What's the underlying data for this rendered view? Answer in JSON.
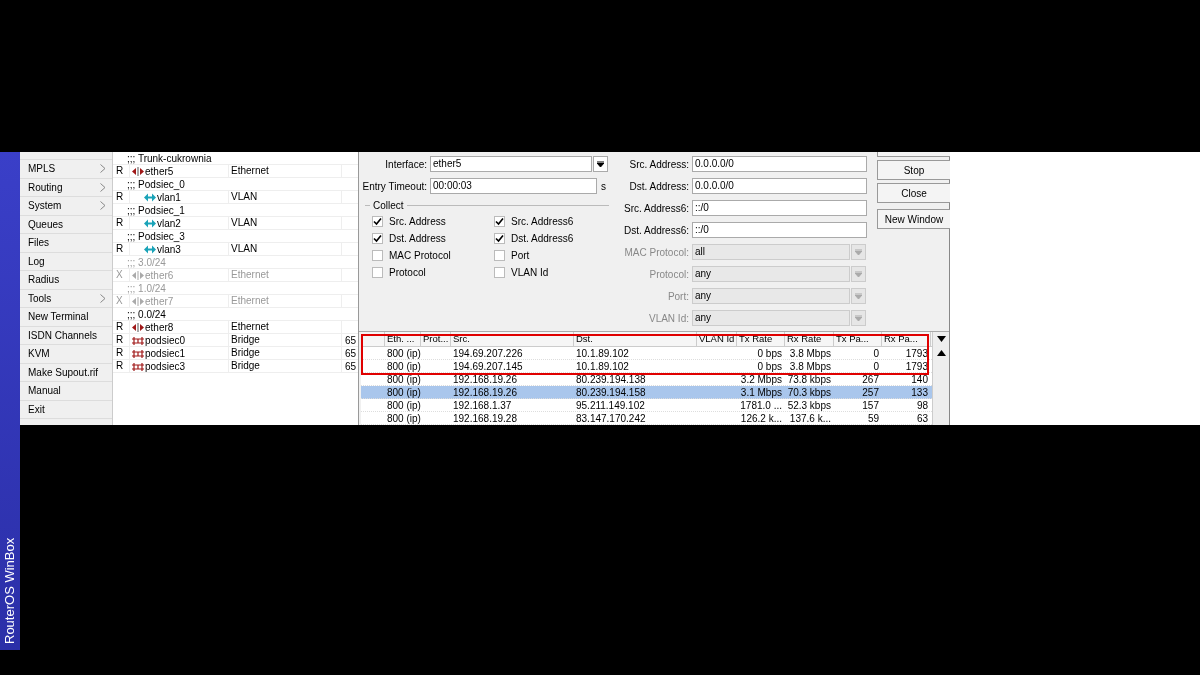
{
  "sidebar_label": "RouterOS WinBox",
  "menu": [
    {
      "label": "MPLS",
      "submenu": true
    },
    {
      "label": "Routing",
      "submenu": true
    },
    {
      "label": "System",
      "submenu": true
    },
    {
      "label": "Queues",
      "submenu": false
    },
    {
      "label": "Files",
      "submenu": false
    },
    {
      "label": "Log",
      "submenu": false
    },
    {
      "label": "Radius",
      "submenu": false
    },
    {
      "label": "Tools",
      "submenu": true
    },
    {
      "label": "New Terminal",
      "submenu": false
    },
    {
      "label": "ISDN Channels",
      "submenu": false
    },
    {
      "label": "KVM",
      "submenu": false
    },
    {
      "label": "Make Supout.rif",
      "submenu": false
    },
    {
      "label": "Manual",
      "submenu": false
    },
    {
      "label": "Exit",
      "submenu": false
    }
  ],
  "interfaces": [
    {
      "kind": "comment",
      "text": ";;; Trunk-cukrownia",
      "disabled": false
    },
    {
      "kind": "ethernet",
      "flag": "R",
      "name": "ether5",
      "type": "Ethernet",
      "disabled": false
    },
    {
      "kind": "comment",
      "text": ";;; Podsiec_0",
      "disabled": false
    },
    {
      "kind": "vlan",
      "flag": "R",
      "name": "vlan1",
      "type": "VLAN",
      "disabled": false
    },
    {
      "kind": "comment",
      "text": ";;; Podsiec_1",
      "disabled": false
    },
    {
      "kind": "vlan",
      "flag": "R",
      "name": "vlan2",
      "type": "VLAN",
      "disabled": false
    },
    {
      "kind": "comment",
      "text": ";;; Podsiec_3",
      "disabled": false
    },
    {
      "kind": "vlan",
      "flag": "R",
      "name": "vlan3",
      "type": "VLAN",
      "disabled": false
    },
    {
      "kind": "comment",
      "text": ";;; 3.0/24",
      "disabled": true
    },
    {
      "kind": "ethernet",
      "flag": "X",
      "name": "ether6",
      "type": "Ethernet",
      "disabled": true
    },
    {
      "kind": "comment",
      "text": ";;; 1.0/24",
      "disabled": true
    },
    {
      "kind": "ethernet",
      "flag": "X",
      "name": "ether7",
      "type": "Ethernet",
      "disabled": true
    },
    {
      "kind": "comment",
      "text": ";;; 0.0/24",
      "disabled": false
    },
    {
      "kind": "ethernet",
      "flag": "R",
      "name": "ether8",
      "type": "Ethernet",
      "disabled": false
    },
    {
      "kind": "bridge",
      "flag": "R",
      "name": "podsiec0",
      "type": "Bridge",
      "column_4": "65",
      "disabled": false
    },
    {
      "kind": "bridge",
      "flag": "R",
      "name": "podsiec1",
      "type": "Bridge",
      "column_4": "65",
      "disabled": false
    },
    {
      "kind": "bridge",
      "flag": "R",
      "name": "podsiec3",
      "type": "Bridge",
      "column_4": "65",
      "disabled": false
    }
  ],
  "form_left": {
    "interface": {
      "label": "Interface:",
      "value": "ether5"
    },
    "entry_timeout": {
      "label": "Entry Timeout:",
      "value": "00:00:03",
      "unit": "s"
    },
    "collect_title": "Collect",
    "collect": [
      {
        "label": "Src. Address",
        "checked": true
      },
      {
        "label": "Src. Address6",
        "checked": true
      },
      {
        "label": "Dst. Address",
        "checked": true
      },
      {
        "label": "Dst. Address6",
        "checked": true
      },
      {
        "label": "MAC Protocol",
        "checked": false
      },
      {
        "label": "Port",
        "checked": false
      },
      {
        "label": "Protocol",
        "checked": false
      },
      {
        "label": "VLAN Id",
        "checked": false
      }
    ]
  },
  "form_right": [
    {
      "label": "Src. Address:",
      "value": "0.0.0.0/0",
      "disabled": false
    },
    {
      "label": "Dst. Address:",
      "value": "0.0.0.0/0",
      "disabled": false
    },
    {
      "label": "Src. Address6:",
      "value": "::/0",
      "disabled": false
    },
    {
      "label": "Dst. Address6:",
      "value": "::/0",
      "disabled": false
    },
    {
      "label": "MAC Protocol:",
      "value": "all",
      "disabled": true
    },
    {
      "label": "Protocol:",
      "value": "any",
      "disabled": true
    },
    {
      "label": "Port:",
      "value": "any",
      "disabled": true
    },
    {
      "label": "VLAN Id:",
      "value": "any",
      "disabled": true
    }
  ],
  "buttons": [
    "Stop",
    "Close",
    "New Window"
  ],
  "table": {
    "columns": [
      "Eth. ...",
      "Prot...",
      "Src.",
      "Dst.",
      "VLAN Id",
      "Tx Rate",
      "Rx Rate",
      "Tx Pa...",
      "Rx Pa..."
    ],
    "rows": [
      {
        "cells": [
          "800 (ip)",
          "",
          "194.69.207.226",
          "10.1.89.102",
          "",
          "0 bps",
          "3.8 Mbps",
          "0",
          "1793"
        ],
        "selected": false,
        "marked": true
      },
      {
        "cells": [
          "800 (ip)",
          "",
          "194.69.207.145",
          "10.1.89.102",
          "",
          "0 bps",
          "3.8 Mbps",
          "0",
          "1793"
        ],
        "selected": false,
        "marked": true
      },
      {
        "cells": [
          "800 (ip)",
          "",
          "192.168.19.26",
          "80.239.194.138",
          "",
          "3.2 Mbps",
          "73.8 kbps",
          "267",
          "140"
        ],
        "selected": false,
        "marked": false
      },
      {
        "cells": [
          "800 (ip)",
          "",
          "192.168.19.26",
          "80.239.194.158",
          "",
          "3.1 Mbps",
          "70.3 kbps",
          "257",
          "133"
        ],
        "selected": true,
        "marked": false
      },
      {
        "cells": [
          "800 (ip)",
          "",
          "192.168.1.37",
          "95.211.149.102",
          "",
          "1781.0 ...",
          "52.3 kbps",
          "157",
          "98"
        ],
        "selected": false,
        "marked": false
      },
      {
        "cells": [
          "800 (ip)",
          "",
          "192.168.19.28",
          "83.147.170.242",
          "",
          "126.2 k...",
          "137.6 k...",
          "59",
          "63"
        ],
        "selected": false,
        "marked": false
      }
    ]
  }
}
